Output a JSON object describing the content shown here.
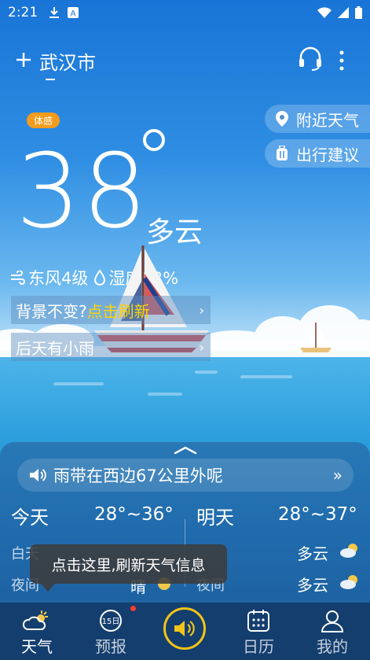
{
  "status_bar": {
    "time": "2:21"
  },
  "header": {
    "city": "武汉市"
  },
  "current": {
    "feels_label": "体感",
    "temperature": "38",
    "condition": "多云",
    "wind": "东风4级",
    "humidity": "湿度53%"
  },
  "side_pills": [
    {
      "label": "附近天气",
      "icon": "location-pin-icon"
    },
    {
      "label": "出行建议",
      "icon": "luggage-icon"
    }
  ],
  "banners": [
    {
      "text": "背景不变?",
      "highlight": "点击刷新"
    },
    {
      "text": "后天有小雨"
    }
  ],
  "alert": {
    "text": "雨带在西边67公里外呢"
  },
  "forecast": {
    "today": {
      "label": "今天",
      "range": "28°~36°",
      "day_label": "白天",
      "night_label": "夜间",
      "night_cond": "晴"
    },
    "tomorrow": {
      "label": "明天",
      "range": "28°~37°",
      "night_label": "夜间",
      "day_cond": "多云",
      "night_cond": "多云"
    }
  },
  "tooltip": {
    "text": "点击这里,刷新天气信息"
  },
  "tabs": [
    {
      "label": "天气",
      "icon": "weather-icon",
      "active": true
    },
    {
      "label": "预报",
      "icon": "forecast-15-day-icon",
      "badge_text": "15日"
    },
    {
      "label": "",
      "icon": "speaker-icon"
    },
    {
      "label": "日历",
      "icon": "calendar-icon"
    },
    {
      "label": "我的",
      "icon": "profile-icon"
    }
  ],
  "colors": {
    "sky_top": "#1874d6",
    "sea": "#1680c9",
    "feels_badge": "#f39b1c",
    "highlight": "#ffd400",
    "voice_ring": "#f2c318",
    "tab_bar": "#143e6e"
  }
}
